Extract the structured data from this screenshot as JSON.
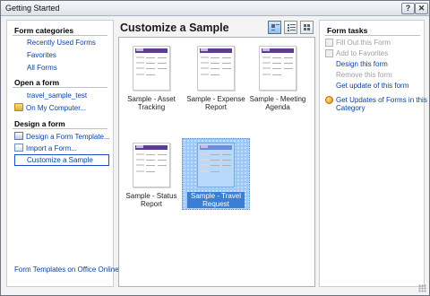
{
  "window": {
    "title": "Getting Started",
    "help_label": "?",
    "close_label": "✕"
  },
  "left": {
    "categories_heading": "Form categories",
    "categories": [
      "Recently Used Forms",
      "Favorites",
      "All Forms"
    ],
    "open_heading": "Open a form",
    "open_recent": "travel_sample_test",
    "open_computer": "On My Computer...",
    "design_heading": "Design a form",
    "design_template": "Design a Form Template...",
    "import_form": "Import a Form...",
    "customize_sample": "Customize a Sample",
    "templates_online": "Form Templates on Office Online"
  },
  "center": {
    "title": "Customize a Sample",
    "view_buttons": [
      "large-icons",
      "details",
      "tiles"
    ],
    "active_view": "large-icons",
    "samples": [
      {
        "line1": "Sample - Asset",
        "line2": "Tracking",
        "selected": false
      },
      {
        "line1": "Sample - Expense",
        "line2": "Report",
        "selected": false
      },
      {
        "line1": "Sample - Meeting",
        "line2": "Agenda",
        "selected": false
      },
      {
        "line1": "Sample - Status",
        "line2": "Report",
        "selected": false
      },
      {
        "line1": "Sample - Travel",
        "line2": "Request",
        "selected": true
      }
    ]
  },
  "right": {
    "heading": "Form tasks",
    "tasks": [
      {
        "label": "Fill Out this Form",
        "enabled": false
      },
      {
        "label": "Add to Favorites",
        "enabled": false
      },
      {
        "label": "Design this form",
        "enabled": true
      },
      {
        "label": "Remove this form",
        "enabled": false
      },
      {
        "label": "Get update of this form",
        "enabled": true
      }
    ],
    "updates_line1": "Get Updates of Forms in this",
    "updates_line2": "Category"
  },
  "colors": {
    "link": "#0a3ea5",
    "selection": "#3a7fd4",
    "form_header": "#5c3d91"
  }
}
